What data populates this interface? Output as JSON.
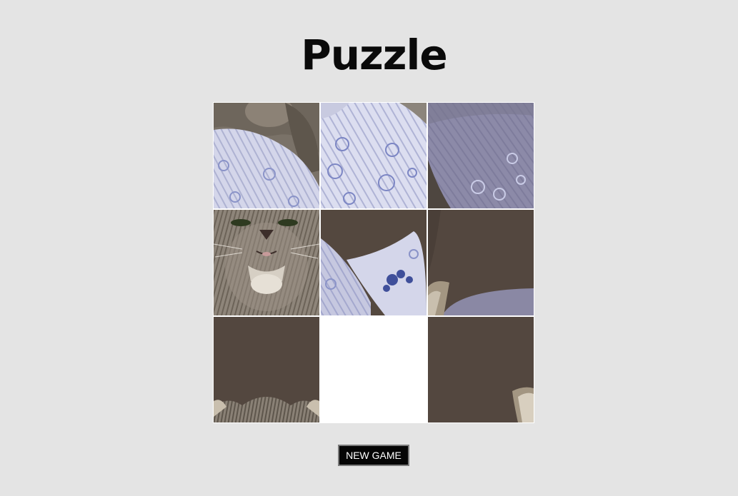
{
  "title": "Puzzle",
  "board": {
    "rows": 3,
    "cols": 3,
    "empty_position": {
      "row": 3,
      "col": 2
    },
    "tiles": [
      {
        "position": "r1c1",
        "content": "kitten-fur-and-pillow"
      },
      {
        "position": "r1c2",
        "content": "striped-floral-pillow"
      },
      {
        "position": "r1c3",
        "content": "floral-pillow-in-shadow"
      },
      {
        "position": "r2c1",
        "content": "kitten-face"
      },
      {
        "position": "r2c2",
        "content": "pillow-with-blue-flower"
      },
      {
        "position": "r2c3",
        "content": "dark-background-ear-tip"
      },
      {
        "position": "r3c1",
        "content": "dark-background-kitten-head-top"
      },
      {
        "position": "r3c2",
        "content": "empty"
      },
      {
        "position": "r3c3",
        "content": "dark-background-ear-corner"
      }
    ]
  },
  "controls": {
    "new_game_label": "NEW GAME"
  },
  "colors": {
    "background": "#e4e4e4",
    "board_gap": "#ffffff",
    "button_bg": "#050505",
    "button_text": "#ffffff",
    "wall_brown": "#53473f",
    "pillow_blue": "#b9bcd6"
  }
}
